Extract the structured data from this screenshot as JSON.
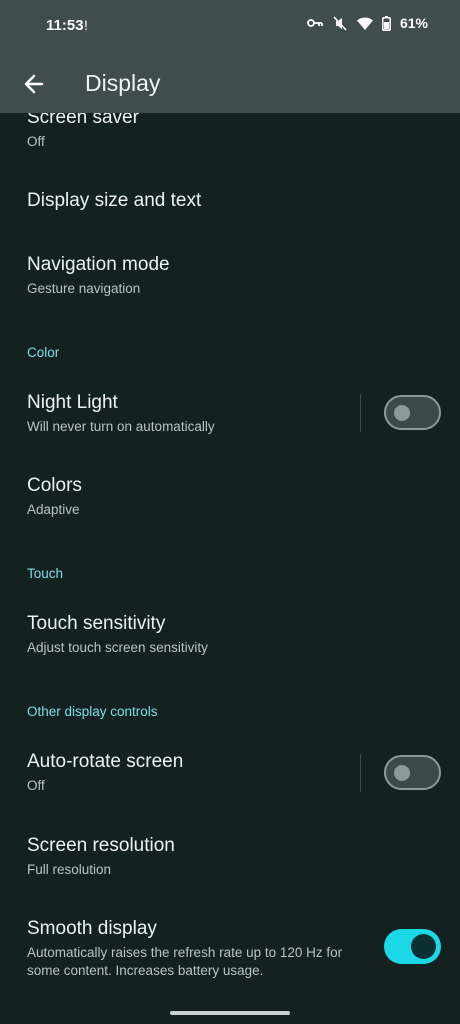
{
  "status": {
    "time": "11:53",
    "alert_icon": "exclamation-icon",
    "battery": "61%",
    "icons": [
      "vpn-key-icon",
      "mute-icon",
      "wifi-icon",
      "battery-icon"
    ]
  },
  "appbar": {
    "title": "Display",
    "back_icon": "arrow-back-icon"
  },
  "items": {
    "screen_saver": {
      "title": "Screen saver",
      "subtitle": "Off"
    },
    "display_size": {
      "title": "Display size and text"
    },
    "navigation_mode": {
      "title": "Navigation mode",
      "subtitle": "Gesture navigation"
    },
    "night_light": {
      "title": "Night Light",
      "subtitle": "Will never turn on automatically",
      "toggle": false
    },
    "colors": {
      "title": "Colors",
      "subtitle": "Adaptive"
    },
    "touch_sensitivity": {
      "title": "Touch sensitivity",
      "subtitle": "Adjust touch screen sensitivity"
    },
    "auto_rotate": {
      "title": "Auto-rotate screen",
      "subtitle": "Off",
      "toggle": false
    },
    "screen_resolution": {
      "title": "Screen resolution",
      "subtitle": "Full resolution"
    },
    "smooth_display": {
      "title": "Smooth display",
      "subtitle": "Automatically raises the refresh rate up to 120 Hz for some content. Increases battery usage.",
      "toggle": true
    }
  },
  "sections": {
    "color": "Color",
    "touch": "Touch",
    "other": "Other display controls"
  },
  "colors": {
    "accent": "#7ddfe8",
    "toggle_on": "#1bd8e6",
    "background": "#132121",
    "appbar": "#404d4c"
  }
}
